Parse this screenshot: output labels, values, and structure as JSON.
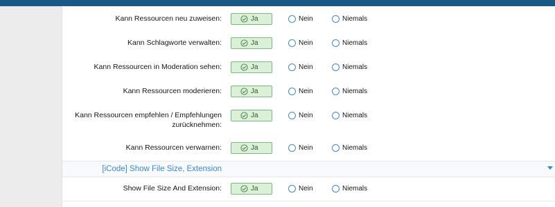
{
  "options": {
    "yes": "Ja",
    "no": "Nein",
    "never": "Niemals"
  },
  "rows": [
    {
      "label": "Kann Ressourcen neu zuweisen:",
      "selected": "Ja"
    },
    {
      "label": "Kann Schlagworte verwalten:",
      "selected": "Ja"
    },
    {
      "label": "Kann Ressourcen in Moderation sehen:",
      "selected": "Ja"
    },
    {
      "label": "Kann Ressourcen moderieren:",
      "selected": "Ja"
    },
    {
      "label": "Kann Ressourcen empfehlen / Empfehlungen zurücknehmen:",
      "selected": "Ja"
    },
    {
      "label": "Kann Ressourcen verwarnen:",
      "selected": "Ja"
    }
  ],
  "section": {
    "title": "[iCode] Show File Size, Extension",
    "rows": [
      {
        "label": "Show File Size And Extension:",
        "selected": "Ja"
      }
    ]
  },
  "colors": {
    "header_bar": "#185886",
    "accent_blue": "#3b88c6",
    "selected_bg": "#dcefd8",
    "selected_border": "#7bb87b"
  },
  "icons": {
    "selected": "check-circle-icon",
    "unselected": "radio-circle-icon",
    "collapse": "caret-down-icon"
  }
}
